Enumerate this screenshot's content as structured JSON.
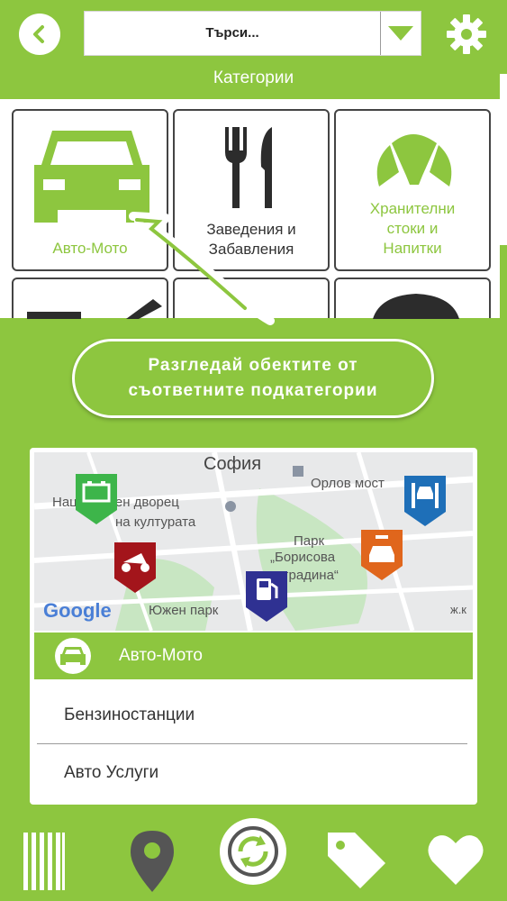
{
  "header": {
    "search_placeholder": "Търси...",
    "section_title": "Категории"
  },
  "categories": [
    {
      "label_line1": "Авто-Мото",
      "label_line2": "",
      "label_line3": "",
      "icon": "car-icon"
    },
    {
      "label_line1": "Заведения и",
      "label_line2": "Забавления",
      "label_line3": "",
      "icon": "fork-knife-icon"
    },
    {
      "label_line1": "Хранителни",
      "label_line2": "стоки и",
      "label_line3": "Напитки",
      "icon": "croissant-icon"
    }
  ],
  "tooltip": {
    "line1": "Разгледай обектите от",
    "line2": "съответните подкатегории"
  },
  "map": {
    "city": "София",
    "labels": {
      "orlov": "Орлов мост",
      "ndk_1": "Национален дворец",
      "ndk_2": "на културата",
      "park_1": "Парк",
      "park_2": "„Борисова",
      "park_3": "градина“",
      "south_park": "Южен парк",
      "jk": "ж.к",
      "google": "Google"
    }
  },
  "selected_category": "Авто-Мото",
  "subcategories": [
    "Бензиностанции",
    "Авто Услуги"
  ],
  "colors": {
    "brand_green": "#8dc63f",
    "car_pin_green": "#3db54a",
    "moto_pin_red": "#a3151b",
    "fuel_pin_blue": "#2f3192",
    "service_pin_orange": "#e0661c",
    "lift_pin_blue": "#1e6fb8"
  }
}
